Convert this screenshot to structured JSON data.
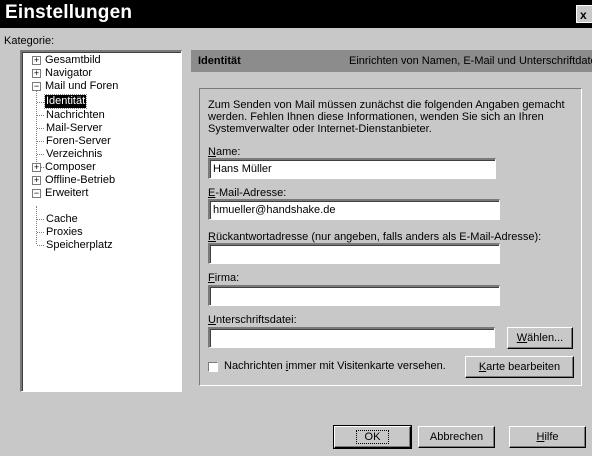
{
  "window": {
    "title": "Einstellungen",
    "close_glyph": "x"
  },
  "category_label": "Kategorie:",
  "tree": {
    "gesamtbild": "Gesamtbild",
    "navigator": "Navigator",
    "mail_und_foren": "Mail und Foren",
    "identitaet": "Identität",
    "nachrichten": "Nachrichten",
    "mail_server": "Mail-Server",
    "foren_server": "Foren-Server",
    "verzeichnis": "Verzeichnis",
    "composer": "Composer",
    "offline_betrieb": "Offline-Betrieb",
    "erweitert": "Erweitert",
    "cache": "Cache",
    "proxies": "Proxies",
    "speicherplatz": "Speicherplatz",
    "expanded_glyph": "−",
    "collapsed_glyph": "+"
  },
  "panel": {
    "title": "Identität",
    "subtitle": "Einrichten von Namen, E-Mail und Unterschriftdatei"
  },
  "intro": "Zum Senden von Mail müssen zunächst die folgenden Angaben gemacht werden. Fehlen Ihnen diese Informationen, wenden Sie sich an Ihren Systemverwalter oder Internet-Dienstanbieter.",
  "fields": {
    "name": {
      "label_u": "N",
      "label_rest": "ame:",
      "value": "Hans Müller"
    },
    "email": {
      "label_u": "E",
      "label_rest": "-Mail-Adresse:",
      "value": "hmueller@handshake.de"
    },
    "reply": {
      "label_u": "R",
      "label_rest": "ückantwortadresse (nur angeben, falls anders als E-Mail-Adresse):",
      "value": ""
    },
    "firma": {
      "label_u": "F",
      "label_rest": "irma:",
      "value": ""
    },
    "signature": {
      "label_u": "U",
      "label_rest": "nterschriftsdatei:",
      "value": ""
    }
  },
  "buttons": {
    "waehlen_u": "W",
    "waehlen_rest": "ählen...",
    "karte_u": "K",
    "karte_rest": "arte bearbeiten",
    "ok": "OK",
    "abbrechen": "Abbrechen",
    "hilfe_u": "H",
    "hilfe_rest": "ilfe"
  },
  "checkbox": {
    "label_pre": "Nachrichten ",
    "label_u": "i",
    "label_post": "mmer mit Visitenkarte versehen.",
    "checked": false
  }
}
